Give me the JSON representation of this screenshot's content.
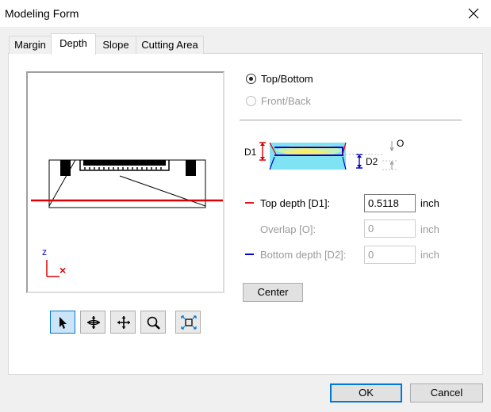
{
  "window": {
    "title": "Modeling Form"
  },
  "tabs": [
    {
      "label": "Margin"
    },
    {
      "label": "Depth"
    },
    {
      "label": "Slope"
    },
    {
      "label": "Cutting Area"
    }
  ],
  "preview": {
    "axis_z": "z",
    "axis_x": "×"
  },
  "toolbar": [
    "select-arrow-icon",
    "rotate-icon",
    "pan-icon",
    "zoom-icon",
    "fit-view-icon"
  ],
  "orientation": {
    "top_bottom_label": "Top/Bottom",
    "front_back_label": "Front/Back",
    "selected": "Top/Bottom"
  },
  "diagram": {
    "d1": "D1",
    "d2": "D2",
    "o": "O"
  },
  "fields": {
    "top_depth": {
      "label": "Top depth [D1]:",
      "value": "0.5118",
      "unit": "inch",
      "color": "#e81123"
    },
    "overlap": {
      "label": "Overlap [O]:",
      "value": "0",
      "unit": "inch"
    },
    "bottom_depth": {
      "label": "Bottom depth [D2]:",
      "value": "0",
      "unit": "inch",
      "color": "#0000cc"
    }
  },
  "buttons": {
    "center": "Center",
    "ok": "OK",
    "cancel": "Cancel"
  }
}
